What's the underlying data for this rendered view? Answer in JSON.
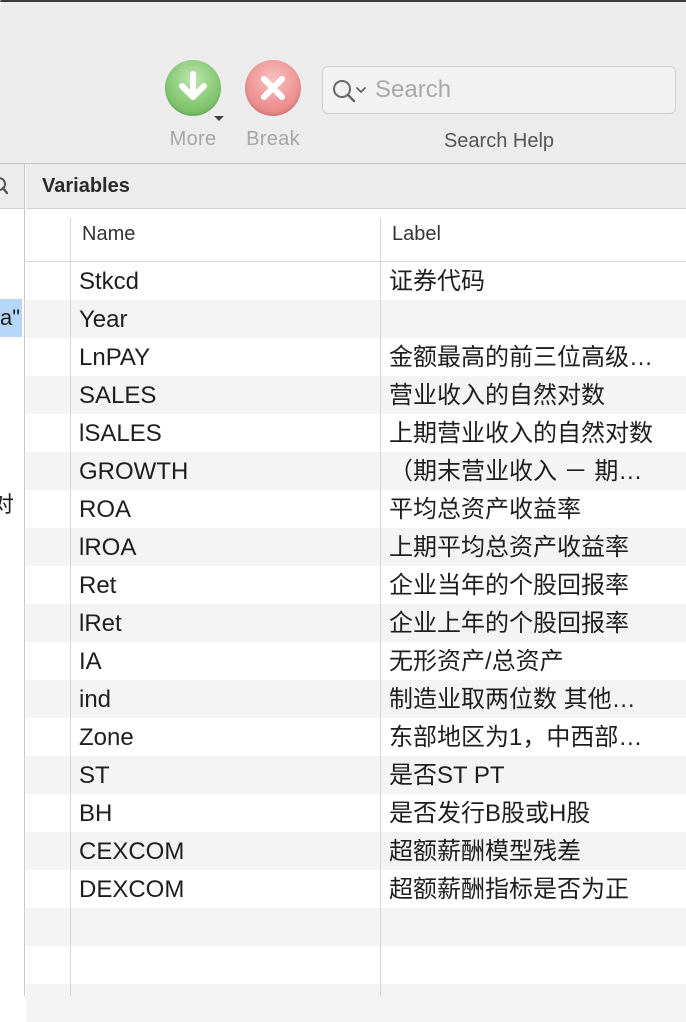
{
  "toolbar": {
    "more_label": "More",
    "break_label": "Break",
    "search_placeholder": "Search",
    "search_help_label": "Search Help"
  },
  "left_panel": {
    "selected_fragment": "a\"",
    "text_fragment": "对"
  },
  "variables": {
    "title": "Variables",
    "columns": {
      "name": "Name",
      "label": "Label"
    },
    "rows": [
      {
        "name": "Stkcd",
        "label": "证券代码"
      },
      {
        "name": "Year",
        "label": ""
      },
      {
        "name": "LnPAY",
        "label": "金额最高的前三位高级…"
      },
      {
        "name": "SALES",
        "label": "营业收入的自然对数"
      },
      {
        "name": "lSALES",
        "label": "上期营业收入的自然对数"
      },
      {
        "name": "GROWTH",
        "label": "（期末营业收入 － 期…"
      },
      {
        "name": "ROA",
        "label": "平均总资产收益率"
      },
      {
        "name": "lROA",
        "label": "上期平均总资产收益率"
      },
      {
        "name": "Ret",
        "label": "企业当年的个股回报率"
      },
      {
        "name": "lRet",
        "label": "企业上年的个股回报率"
      },
      {
        "name": "IA",
        "label": "无形资产/总资产"
      },
      {
        "name": "ind",
        "label": "制造业取两位数 其他…"
      },
      {
        "name": "Zone",
        "label": "东部地区为1，中西部…"
      },
      {
        "name": "ST",
        "label": "是否ST PT"
      },
      {
        "name": "BH",
        "label": "是否发行B股或H股"
      },
      {
        "name": "CEXCOM",
        "label": "超额薪酬模型残差"
      },
      {
        "name": "DEXCOM",
        "label": "超额薪酬指标是否为正"
      },
      {
        "name": "",
        "label": ""
      },
      {
        "name": "",
        "label": ""
      },
      {
        "name": "",
        "label": ""
      }
    ]
  },
  "colors": {
    "toolbar_bg": "#ececec",
    "selection": "#b6d7f7",
    "more_icon": "#86c873",
    "break_icon": "#ee9494"
  }
}
